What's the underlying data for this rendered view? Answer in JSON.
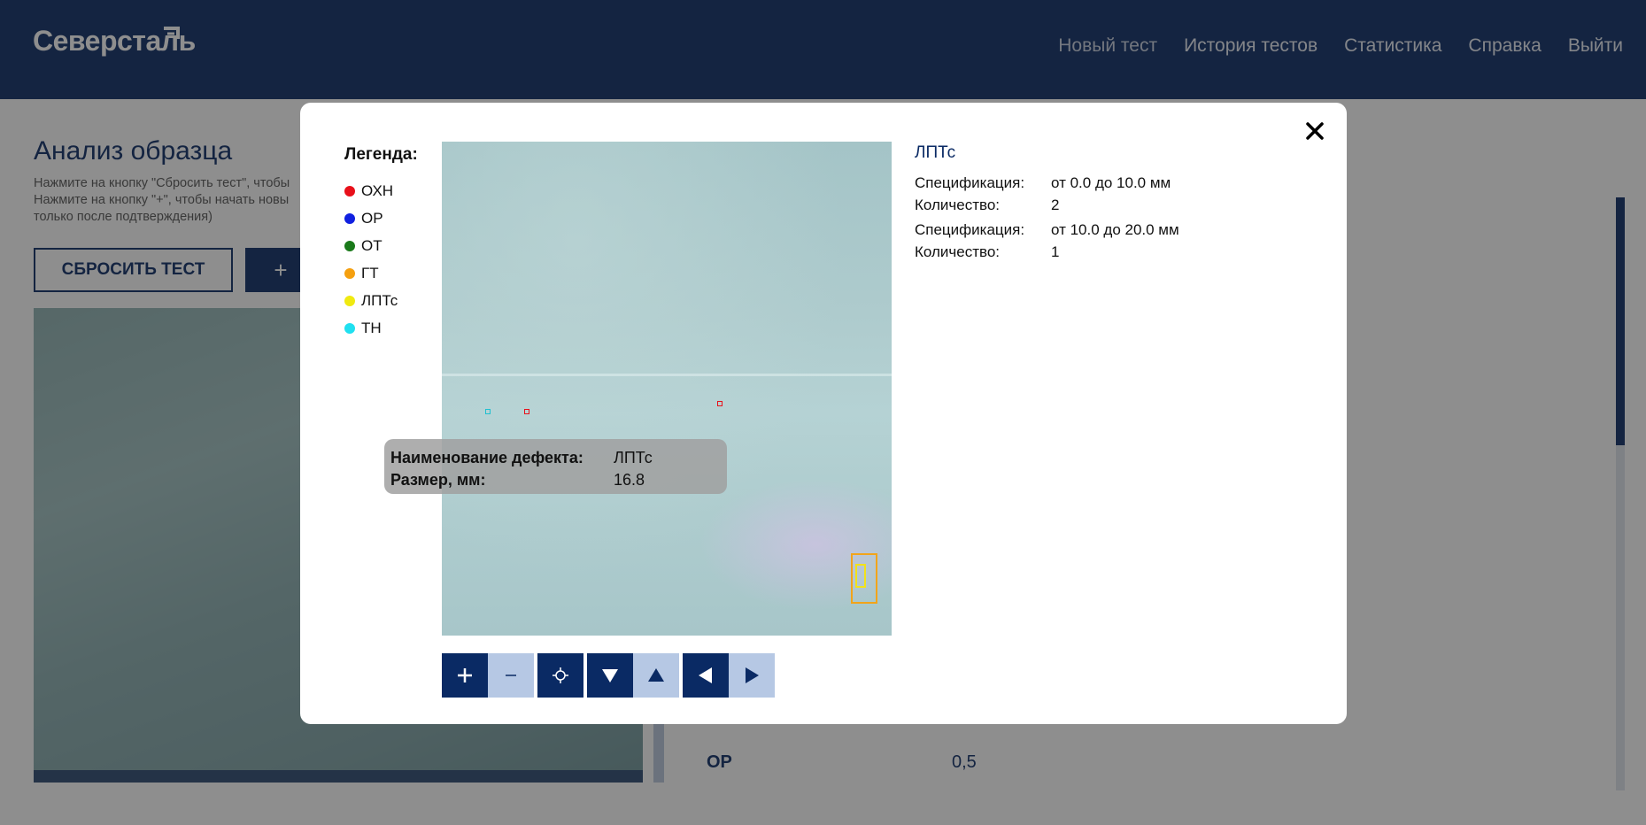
{
  "header": {
    "logo_text": "Северсталь",
    "nav": [
      "Новый тест",
      "История тестов",
      "Статистика",
      "Справка",
      "Выйти"
    ]
  },
  "page": {
    "title": "Анализ образца",
    "hint_line1": "Нажмите на кнопку \"Сбросить тест\", чтобы",
    "hint_line2": "Нажмите на кнопку \"+\", чтобы начать новы",
    "hint_line3": "только после подтверждения)",
    "reset_button": "СБРОСИТЬ ТЕСТ",
    "plus_button": "+"
  },
  "right_panel": {
    "row_label": "ОР",
    "row_value": "0,5"
  },
  "modal": {
    "legend_title": "Легенда:",
    "legend": [
      {
        "label": "ОХН",
        "color": "#e8101a"
      },
      {
        "label": "ОР",
        "color": "#1020e0"
      },
      {
        "label": "ОТ",
        "color": "#1a7a1a"
      },
      {
        "label": "ГТ",
        "color": "#f5a010"
      },
      {
        "label": "ЛПТс",
        "color": "#f0ea10"
      },
      {
        "label": "ТН",
        "color": "#20e0f0"
      }
    ],
    "tooltip": {
      "name_key": "Наименование дефекта:",
      "name_value": "ЛПТс",
      "size_key": "Размер, мм:",
      "size_value": "16.8"
    },
    "info": {
      "title": "ЛПТс",
      "groups": [
        {
          "spec_key": "Спецификация:",
          "spec_value": "от 0.0 до 10.0 мм",
          "count_key": "Количество:",
          "count_value": "2"
        },
        {
          "spec_key": "Спецификация:",
          "spec_value": "от 10.0 до 20.0 мм",
          "count_key": "Количество:",
          "count_value": "1"
        }
      ]
    },
    "toolbar": {
      "zoom_in": "+",
      "zoom_out": "–"
    }
  }
}
